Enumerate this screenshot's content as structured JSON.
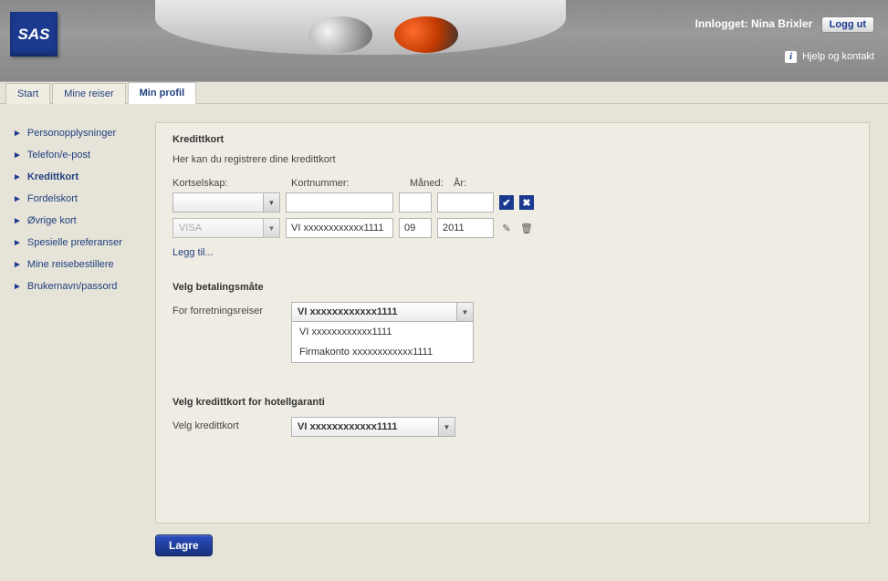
{
  "header": {
    "logo_text": "SAS",
    "logged_in_prefix": "Innlogget:",
    "user_name": "Nina Brixler",
    "logout_label": "Logg ut",
    "help_label": "Hjelp og kontakt"
  },
  "tabs": [
    {
      "label": "Start",
      "active": false
    },
    {
      "label": "Mine reiser",
      "active": false
    },
    {
      "label": "Min profil",
      "active": true
    }
  ],
  "sidebar": {
    "items": [
      {
        "label": "Personopplysninger",
        "active": false
      },
      {
        "label": "Telefon/e-post",
        "active": false
      },
      {
        "label": "Kredittkort",
        "active": true
      },
      {
        "label": "Fordelskort",
        "active": false
      },
      {
        "label": "Øvrige kort",
        "active": false
      },
      {
        "label": "Spesielle preferanser",
        "active": false
      },
      {
        "label": "Mine reisebestillere",
        "active": false
      },
      {
        "label": "Brukernavn/passord",
        "active": false
      }
    ]
  },
  "panel": {
    "title": "Kredittkort",
    "intro": "Her kan du registrere dine kredittkort",
    "labels": {
      "company": "Kortselskap:",
      "number": "Kortnummer:",
      "month": "Måned:",
      "year": "År:"
    },
    "new_row": {
      "company": "",
      "number": "",
      "month": "",
      "year": ""
    },
    "existing_row": {
      "company": "VISA",
      "number": "VI xxxxxxxxxxxx1111",
      "month": "09",
      "year": "2011"
    },
    "add_link": "Legg til...",
    "payment_section_title": "Velg betalingsmåte",
    "payment_label": "For forretningsreiser",
    "payment_selected": "VI xxxxxxxxxxxx1111",
    "payment_options": [
      "VI xxxxxxxxxxxx1111",
      "Firmakonto xxxxxxxxxxxx1111"
    ],
    "hotel_section_title": "Velg kredittkort for hotellgaranti",
    "hotel_label": "Velg kredittkort",
    "hotel_selected": "VI xxxxxxxxxxxx1111"
  },
  "save_label": "Lagre"
}
